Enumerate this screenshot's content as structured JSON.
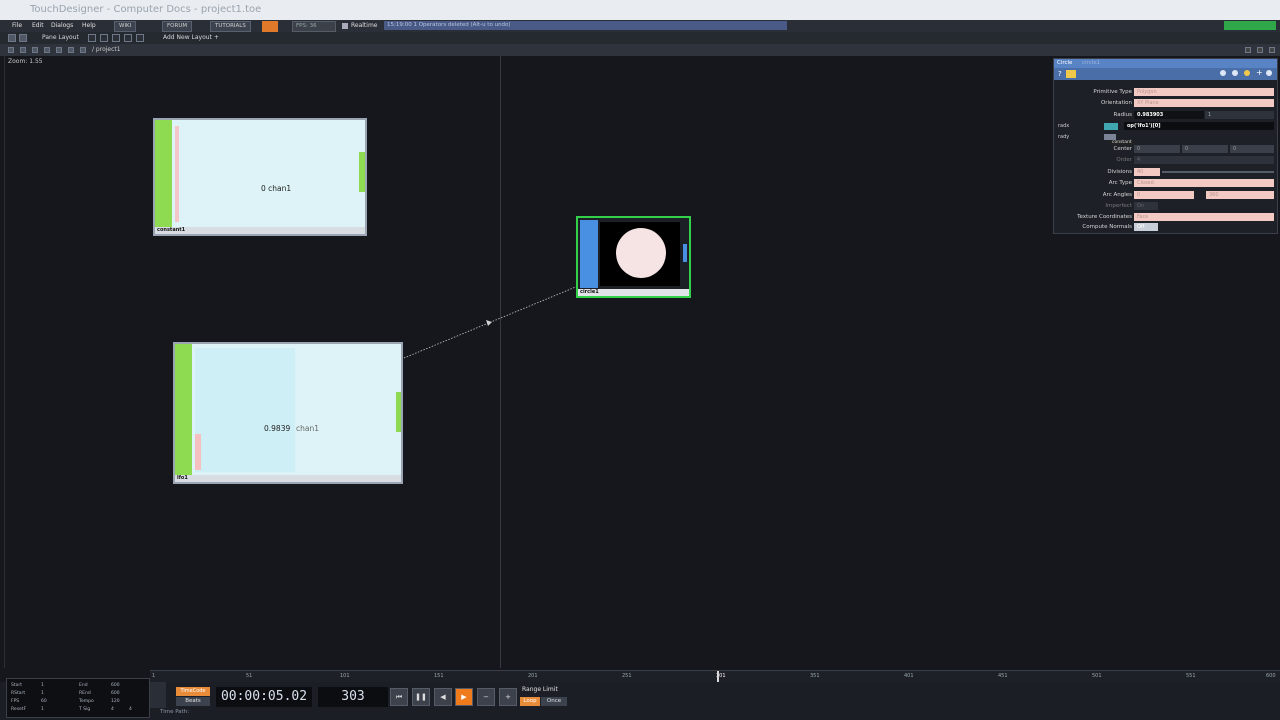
{
  "titlebar": {
    "title": "TouchDesigner - Computer Docs - project1.toe"
  },
  "menu": {
    "items": [
      "File",
      "Edit",
      "Dialogs",
      "Help"
    ],
    "wiki": "WIKI",
    "forum": "FORUM",
    "tutorials": "TUTORIALS",
    "fps": "FPS: 36",
    "realtime": "Realtime",
    "status": "15:19:00 1 Operators deleted (Alt-u to undo)"
  },
  "toolbar": {
    "pane_layout": "Pane Layout",
    "add_layout": "Add New Layout +"
  },
  "path": {
    "current": "/ project1"
  },
  "network": {
    "zoom": "Zoom: 1.55"
  },
  "nodes": {
    "constant1": {
      "name": "constant1",
      "text": "0 chan1"
    },
    "lfo1": {
      "name": "lfo1",
      "value": "0.9839",
      "channel": "chan1"
    },
    "circle1": {
      "name": "circle1"
    }
  },
  "params": {
    "title": "Circle",
    "subtitle": "circle1",
    "rows": [
      {
        "label": "Primitive Type",
        "value": "Polygon"
      },
      {
        "label": "Orientation",
        "value": "XY Plane"
      },
      {
        "label": "Radius",
        "value": "0.983903",
        "value2": "1"
      },
      {
        "label": "radx",
        "value": "op('lfo1')[0]"
      },
      {
        "label": "rady",
        "value": ""
      },
      {
        "label": "Center",
        "value": "0",
        "value2": "0",
        "value3": "0"
      },
      {
        "label": "Order",
        "value": "4"
      },
      {
        "label": "Divisions",
        "value": "40"
      },
      {
        "label": "Arc Type",
        "value": "Closed"
      },
      {
        "label": "Arc Angles",
        "value": "0",
        "value2": "360"
      },
      {
        "label": "Imperfect",
        "value": "On"
      },
      {
        "label": "Texture Coordinates",
        "value": "Face"
      },
      {
        "label": "Compute Normals",
        "value": "Off"
      }
    ],
    "tooltip": "constant"
  },
  "timeline": {
    "ticks": [
      "1",
      "51",
      "101",
      "151",
      "201",
      "251",
      "301",
      "351",
      "401",
      "451",
      "501",
      "551",
      "600"
    ]
  },
  "transport": {
    "timecode": "00:00:05.02",
    "frame": "303",
    "timecode_btn": "TimeCode",
    "beats_btn": "Beats",
    "range_label": "Range Limit",
    "loop": "Loop",
    "once": "Once",
    "time_path": "Time Path:"
  },
  "info": {
    "start": "1",
    "end": "600",
    "rstart": "1",
    "rend": "600",
    "fps": "60",
    "tempo": "120",
    "resetf": "1",
    "tsig1": "4",
    "tsig2": "4"
  }
}
